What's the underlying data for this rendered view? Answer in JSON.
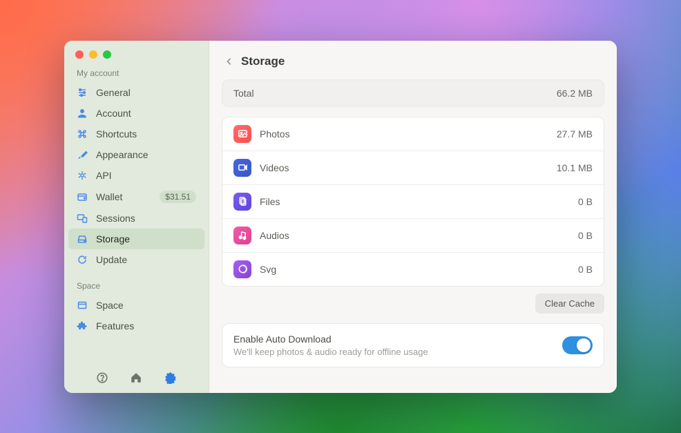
{
  "sidebar": {
    "section_account": "My account",
    "section_space": "Space",
    "items": [
      {
        "label": "General"
      },
      {
        "label": "Account"
      },
      {
        "label": "Shortcuts"
      },
      {
        "label": "Appearance"
      },
      {
        "label": "API"
      },
      {
        "label": "Wallet",
        "badge": "$31.51"
      },
      {
        "label": "Sessions"
      },
      {
        "label": "Storage"
      },
      {
        "label": "Update"
      }
    ],
    "space_items": [
      {
        "label": "Space"
      },
      {
        "label": "Features"
      }
    ]
  },
  "header": {
    "title": "Storage"
  },
  "total": {
    "label": "Total",
    "value": "66.2 MB"
  },
  "media": [
    {
      "label": "Photos",
      "value": "27.7 MB"
    },
    {
      "label": "Videos",
      "value": "10.1 MB"
    },
    {
      "label": "Files",
      "value": "0 B"
    },
    {
      "label": "Audios",
      "value": "0 B"
    },
    {
      "label": "Svg",
      "value": "0 B"
    }
  ],
  "buttons": {
    "clear_cache": "Clear Cache"
  },
  "auto_download": {
    "title": "Enable Auto Download",
    "subtitle": "We'll keep photos & audio ready for offline usage",
    "enabled": true
  }
}
